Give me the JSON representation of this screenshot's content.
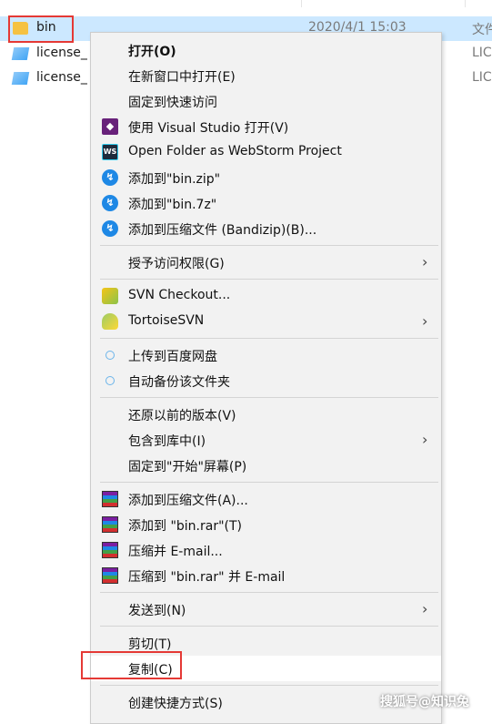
{
  "explorer": {
    "files": [
      {
        "name": "bin",
        "date": "2020/4/1 15:03",
        "type": "文件",
        "icon": "folder-icon",
        "selected": true
      },
      {
        "name": "license_",
        "date": "",
        "type": "LIC",
        "icon": "license-file-icon",
        "selected": false
      },
      {
        "name": "license_",
        "date": "",
        "type": "LIC",
        "icon": "license-file-icon",
        "selected": false
      }
    ]
  },
  "menu": {
    "items": [
      {
        "label": "打开(O)",
        "icon": "",
        "bold": true
      },
      {
        "label": "在新窗口中打开(E)",
        "icon": ""
      },
      {
        "label": "固定到快速访问",
        "icon": ""
      },
      {
        "label": "使用 Visual Studio 打开(V)",
        "icon": "visual-studio-icon"
      },
      {
        "label": "Open Folder as WebStorm Project",
        "icon": "webstorm-icon"
      },
      {
        "label": "添加到\"bin.zip\"",
        "icon": "bandizip-icon"
      },
      {
        "label": "添加到\"bin.7z\"",
        "icon": "bandizip-icon"
      },
      {
        "label": "添加到压缩文件 (Bandizip)(B)...",
        "icon": "bandizip-icon"
      },
      {
        "label": "授予访问权限(G)",
        "icon": "",
        "submenu": true
      },
      {
        "label": "SVN Checkout...",
        "icon": "svn-checkout-icon"
      },
      {
        "label": "TortoiseSVN",
        "icon": "tortoisesvn-icon",
        "submenu": true
      },
      {
        "label": "上传到百度网盘",
        "icon": "baidu-cloud-icon"
      },
      {
        "label": "自动备份该文件夹",
        "icon": "baidu-cloud-icon"
      },
      {
        "label": "还原以前的版本(V)",
        "icon": ""
      },
      {
        "label": "包含到库中(I)",
        "icon": "",
        "submenu": true
      },
      {
        "label": "固定到\"开始\"屏幕(P)",
        "icon": ""
      },
      {
        "label": "添加到压缩文件(A)...",
        "icon": "winrar-icon"
      },
      {
        "label": "添加到 \"bin.rar\"(T)",
        "icon": "winrar-icon"
      },
      {
        "label": "压缩并 E-mail...",
        "icon": "winrar-icon"
      },
      {
        "label": "压缩到 \"bin.rar\" 并 E-mail",
        "icon": "winrar-icon"
      },
      {
        "label": "发送到(N)",
        "icon": "",
        "submenu": true
      },
      {
        "label": "剪切(T)",
        "icon": ""
      },
      {
        "label": "复制(C)",
        "icon": "",
        "hovered": true
      },
      {
        "label": "创建快捷方式(S)",
        "icon": ""
      }
    ],
    "submenu_arrow": "›"
  },
  "watermark": "搜狐号@知识兔"
}
